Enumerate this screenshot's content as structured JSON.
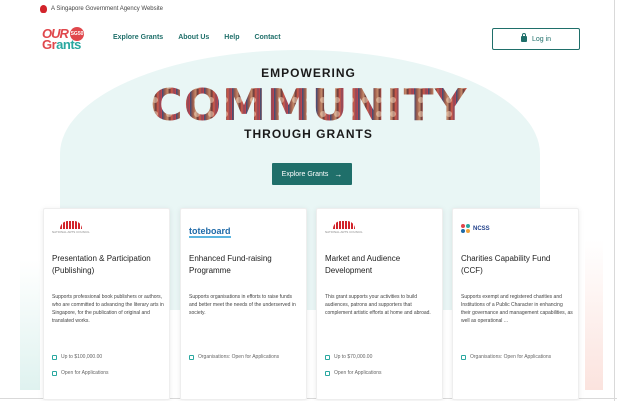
{
  "gov_banner": {
    "text": "A Singapore Government Agency Website"
  },
  "brand": {
    "logo_top": "OUR",
    "logo_badge": "SG50",
    "logo_bottom_a": "Gr",
    "logo_bottom_b": "ants"
  },
  "nav": {
    "items": [
      "Explore Grants",
      "About Us",
      "Help",
      "Contact"
    ]
  },
  "login": {
    "label": "Log in"
  },
  "hero": {
    "line1": "EMPOWERING",
    "line2": "COMMUNITY",
    "line3": "THROUGH GRANTS",
    "cta_label": "Explore Grants",
    "cta_arrow": "→"
  },
  "cards": [
    {
      "logo": "nac",
      "title": "Presentation & Participation (Publishing)",
      "description": "Supports professional book publishers or authors, who are committed to advancing the literary arts in Singapore, for the publication of original and translated works.",
      "meta1": "Up to $100,000.00",
      "meta2": "Open for Applications"
    },
    {
      "logo": "toteboard",
      "logo_text": "toteboard",
      "title": "Enhanced Fund-raising Programme",
      "description": "Supports organisations in efforts to raise funds and better meet the needs of the underserved in society.",
      "meta1": "Organisations: Open for Applications",
      "meta2": ""
    },
    {
      "logo": "nac",
      "title": "Market and Audience Development",
      "description": "This grant supports your activities to build audiences, patrons and supporters that complement artistic efforts at home and abroad.",
      "meta1": "Up to $70,000.00",
      "meta2": "Open for Applications"
    },
    {
      "logo": "ncss",
      "logo_text": "NCSS",
      "title": "Charities Capability Fund (CCF)",
      "description": "Supports exempt and registered charities and Institutions of a Public Character in enhancing their governance and management capabilities, as well as operational ...",
      "meta1": "Organisations: Open for Applications",
      "meta2": ""
    }
  ],
  "colors": {
    "primary": "#1f6f6a",
    "brand_red": "#e0474c",
    "brand_teal": "#2aa8a0",
    "hero_bg": "#e9f6f5"
  }
}
